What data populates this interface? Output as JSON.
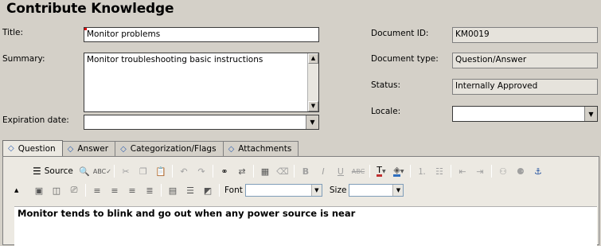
{
  "page": {
    "title": "Contribute Knowledge"
  },
  "form": {
    "title_label": "Title:",
    "title_value": "Monitor problems",
    "summary_label": "Summary:",
    "summary_value": "Monitor troubleshooting basic instructions",
    "expiration_label": "Expiration date:",
    "expiration_value": "",
    "docid_label": "Document ID:",
    "docid_value": "KM0019",
    "doctype_label": "Document type:",
    "doctype_value": "Question/Answer",
    "status_label": "Status:",
    "status_value": "Internally Approved",
    "locale_label": "Locale:",
    "locale_value": ""
  },
  "tabs": [
    {
      "label": "Question",
      "active": true
    },
    {
      "label": "Answer"
    },
    {
      "label": "Categorization/Flags"
    },
    {
      "label": "Attachments"
    }
  ],
  "toolbar": {
    "source_label": "Source",
    "font_label": "Font",
    "font_value": "",
    "size_label": "Size",
    "size_value": ""
  },
  "editor": {
    "content": "Monitor tends to blink and go out when any power source is near"
  }
}
